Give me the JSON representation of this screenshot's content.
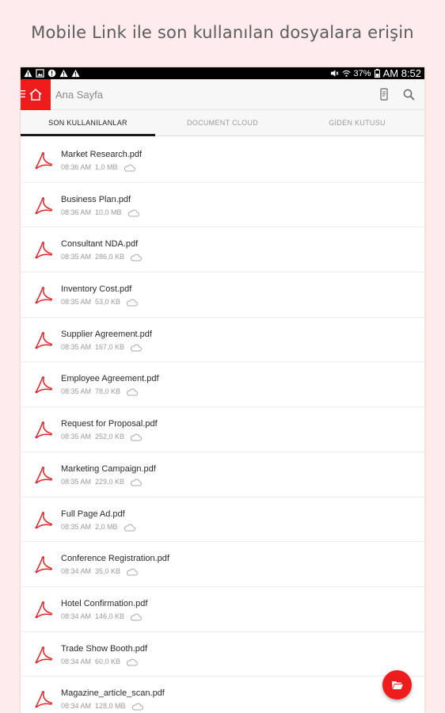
{
  "headline": "Mobile Link ile son kullanılan dosyalara erişin",
  "status_bar": {
    "battery": "37%",
    "time": "AM 8:52"
  },
  "app_bar": {
    "title": "Ana Sayfa",
    "accent_color": "#ee1c1c"
  },
  "tabs": [
    {
      "label": "SON KULLANILANLAR",
      "active": true
    },
    {
      "label": "DOCUMENT CLOUD",
      "active": false
    },
    {
      "label": "GİDEN KUTUSU",
      "active": false
    }
  ],
  "files": [
    {
      "name": "Market Research.pdf",
      "time": "08:36 AM",
      "size": "1,0 MB"
    },
    {
      "name": "Business Plan.pdf",
      "time": "08:36 AM",
      "size": "10,0 MB"
    },
    {
      "name": "Consultant NDA.pdf",
      "time": "08:35 AM",
      "size": "286,0 KB"
    },
    {
      "name": "Inventory Cost.pdf",
      "time": "08:35 AM",
      "size": "53,0 KB"
    },
    {
      "name": "Supplier Agreement.pdf",
      "time": "08:35 AM",
      "size": "167,0 KB"
    },
    {
      "name": "Employee Agreement.pdf",
      "time": "08:35 AM",
      "size": "78,0 KB"
    },
    {
      "name": "Request for Proposal.pdf",
      "time": "08:35 AM",
      "size": "252,0 KB"
    },
    {
      "name": "Marketing Campaign.pdf",
      "time": "08:35 AM",
      "size": "229,0 KB"
    },
    {
      "name": "Full Page Ad.pdf",
      "time": "08:35 AM",
      "size": "2,0 MB"
    },
    {
      "name": "Conference Registration.pdf",
      "time": "08:34 AM",
      "size": "35,0 KB"
    },
    {
      "name": "Hotel Confirmation.pdf",
      "time": "08:34 AM",
      "size": "146,0 KB"
    },
    {
      "name": "Trade Show Booth.pdf",
      "time": "08:34 AM",
      "size": "60,0 KB"
    },
    {
      "name": "Magazine_article_scan.pdf",
      "time": "08:34 AM",
      "size": "128,0 MB"
    }
  ],
  "icons": {
    "file": "pdf-icon",
    "storage": "cloud-icon",
    "fab": "folder-open-icon"
  }
}
